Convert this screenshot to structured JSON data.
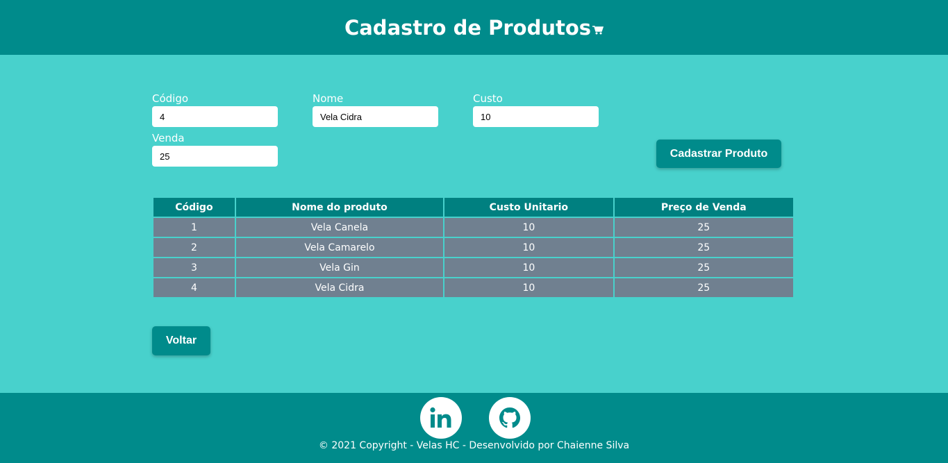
{
  "header": {
    "title": "Cadastro de Produtos",
    "icon": "cart-icon"
  },
  "form": {
    "codigo": {
      "label": "Código",
      "value": "4"
    },
    "nome": {
      "label": "Nome",
      "value": "Vela Cidra"
    },
    "custo": {
      "label": "Custo",
      "value": "10"
    },
    "venda": {
      "label": "Venda",
      "value": "25"
    },
    "submit_label": "Cadastrar Produto"
  },
  "table": {
    "headers": [
      "Código",
      "Nome do produto",
      "Custo Unitario",
      "Preço de Venda"
    ],
    "rows": [
      [
        "1",
        "Vela Canela",
        "10",
        "25"
      ],
      [
        "2",
        "Vela Camarelo",
        "10",
        "25"
      ],
      [
        "3",
        "Vela Gin",
        "10",
        "25"
      ],
      [
        "4",
        "Vela Cidra",
        "10",
        "25"
      ]
    ]
  },
  "back_label": "Voltar",
  "footer": {
    "social": [
      {
        "name": "linkedin-icon"
      },
      {
        "name": "github-icon"
      }
    ],
    "copyright": "© 2021 Copyright - Velas HC - Desenvolvido por Chaienne Silva"
  },
  "colors": {
    "header_bg": "#008b8b",
    "page_bg": "#48d1cc",
    "table_header_bg": "#008080",
    "table_row_bg": "#708090",
    "button_bg": "#008b8b"
  }
}
